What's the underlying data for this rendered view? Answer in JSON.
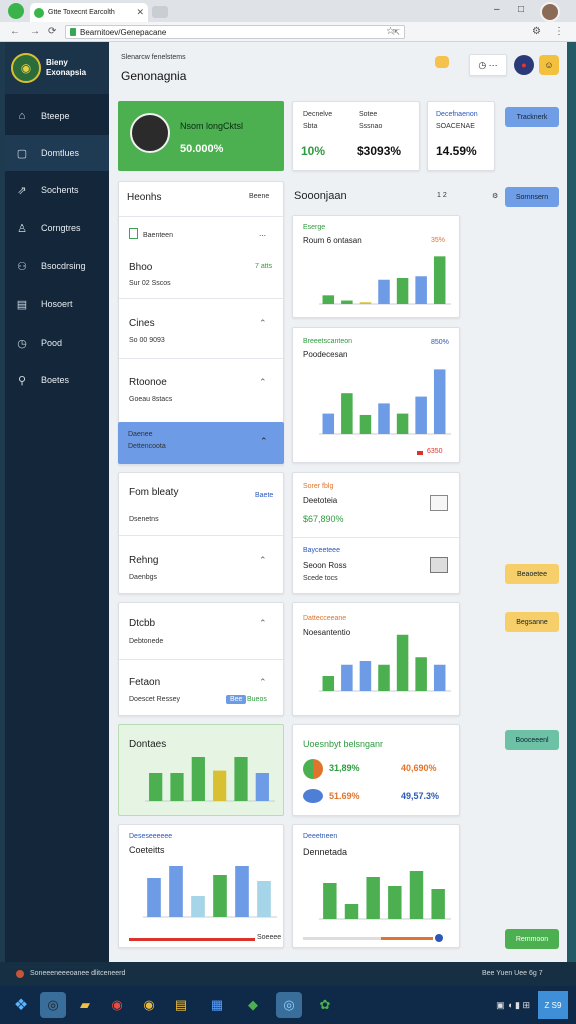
{
  "browser": {
    "tab_title": "Gtte Toxecnt Earcolth",
    "url": "Bearnitoev/Genepacane",
    "controls": {
      "min": "–",
      "max": "□",
      "close": "✕"
    }
  },
  "sidebar": {
    "brand_line1": "Bieny",
    "brand_line2": "Exonapsia",
    "items": [
      {
        "label": "Bteepe",
        "icon": "home-icon",
        "glyph": "⌂"
      },
      {
        "label": "Domtlues",
        "icon": "document-icon",
        "glyph": "▢"
      },
      {
        "label": "Sochents",
        "icon": "share-icon",
        "glyph": "⇗"
      },
      {
        "label": "Corngtres",
        "icon": "user-icon",
        "glyph": "♙"
      },
      {
        "label": "Bsocdrsing",
        "icon": "people-icon",
        "glyph": "⚇"
      },
      {
        "label": "Hosoert",
        "icon": "calendar-icon",
        "glyph": "▤"
      },
      {
        "label": "Pood",
        "icon": "clock-icon",
        "glyph": "◷"
      },
      {
        "label": "Boetes",
        "icon": "search-icon",
        "glyph": "⚲"
      }
    ]
  },
  "header": {
    "subtitle": "Slenarcw fenelstems",
    "title": "Genonagnia"
  },
  "profile_card": {
    "name": "Nsom longCktsl",
    "value": "50.000%"
  },
  "stat_cards": [
    {
      "label1": "Decnelve",
      "label2": "Sbta",
      "label3": "Sotee",
      "label4": "Sssnao",
      "value1": "10%",
      "value2": "$3093%"
    },
    {
      "label1": "Decefnaenon",
      "label2": "SOACENAE",
      "value1": "14.59%"
    }
  ],
  "side_buttons": {
    "top": "Tracknerk",
    "list": "Sornnsern",
    "yellow1": "Beaoetee",
    "yellow2": "Begsanne",
    "teal": "Booceeenl",
    "green": "Remmoon"
  },
  "left_list": {
    "header": "Heonhs",
    "header_right": "Beene",
    "items": [
      {
        "small": "Baenteen",
        "title": "Bhoo",
        "sub": "Sur 02 Sscos",
        "right": "7 atts"
      },
      {
        "title": "Cines",
        "sub": "So 00 9093"
      },
      {
        "title": "Rtoonoe",
        "sub": "Goeau 8stacs"
      },
      {
        "title": "Daenee",
        "sub": "Dettencoota"
      }
    ]
  },
  "left_cards": [
    {
      "title": "Fom bleaty",
      "sub": "Dsenetns",
      "right": "Baete",
      "title2": "Rehng",
      "sub2": "Daenbgs"
    },
    {
      "title": "Dtcbb",
      "sub": "Debtonede",
      "title2": "Fetaon",
      "sub2": "Doescet Ressey",
      "badge": "Bee",
      "badge2": "Bueos"
    }
  ],
  "mid_header": {
    "title": "Sooonjaan",
    "pager": "1  2"
  },
  "charts_mid": [
    {
      "label": "Eserge",
      "title": "Roum 6 ontasan",
      "right": "35%"
    },
    {
      "label": "Breeetscanteon",
      "title": "Poodecesan",
      "right": "850%",
      "legend": "6350"
    },
    {
      "label": "Sorer fblg",
      "title": "Deetoteia",
      "value": "$67,890%",
      "label2": "Bayceeteee",
      "title2": "Seoon Ross",
      "sub2": "Scede tocs"
    },
    {
      "label": "Dattecceeane",
      "title": "Noesantentio"
    }
  ],
  "green_card": {
    "title": "Dontaes"
  },
  "bottom_right_card": {
    "title": "Uoesnbyt belsnganr",
    "row1": {
      "pct": "31,89%",
      "val": "40,690%"
    },
    "row2": {
      "pct": "51.69%",
      "val": "49,57.3%"
    }
  },
  "bottom_left_chart": {
    "label": "Deseseeeeee",
    "title": "Coeteitts",
    "footer": "Soeeee"
  },
  "bottom_mid_chart": {
    "label": "Deeetneen",
    "title": "Dennetada"
  },
  "status": {
    "left": "Soneeeneeeoanee dlitceneerd",
    "right": "Bee Yuen Uee 6g 7"
  },
  "chart_data": [
    {
      "type": "bar",
      "title": "Roum 6 ontasan",
      "series": [
        {
          "values": [
            10,
            4,
            2,
            28,
            30,
            32,
            55
          ]
        }
      ],
      "ylim": [
        0,
        60
      ]
    },
    {
      "type": "bar",
      "title": "Poodecesan",
      "series": [
        {
          "values": [
            30,
            60,
            28,
            45,
            30,
            55,
            95
          ]
        }
      ],
      "ylim": [
        0,
        100
      ]
    },
    {
      "type": "bar",
      "title": "Noesantentio",
      "series": [
        {
          "values": [
            20,
            35,
            40,
            35,
            75,
            45,
            35
          ]
        }
      ],
      "ylim": [
        0,
        80
      ]
    },
    {
      "type": "bar",
      "title": "Dontaes",
      "series": [
        {
          "values": [
            35,
            35,
            55,
            38,
            55,
            35
          ]
        }
      ],
      "ylim": [
        0,
        60
      ]
    },
    {
      "type": "bar",
      "title": "Coeteitts",
      "series": [
        {
          "values": [
            65,
            85,
            35,
            70,
            85,
            60
          ]
        }
      ],
      "ylim": [
        0,
        100
      ]
    },
    {
      "type": "bar",
      "title": "Dennetada",
      "series": [
        {
          "values": [
            60,
            25,
            70,
            55,
            80,
            50
          ]
        }
      ],
      "ylim": [
        0,
        100
      ]
    }
  ],
  "taskbar": {
    "time": "Z S9",
    "apps": [
      "windows-icon",
      "chrome-icon",
      "folder-icon",
      "chrome-icon",
      "chrome-icon",
      "notes-icon",
      "calendar-icon",
      "gem-icon",
      "chrome-icon",
      "settings-icon"
    ]
  }
}
